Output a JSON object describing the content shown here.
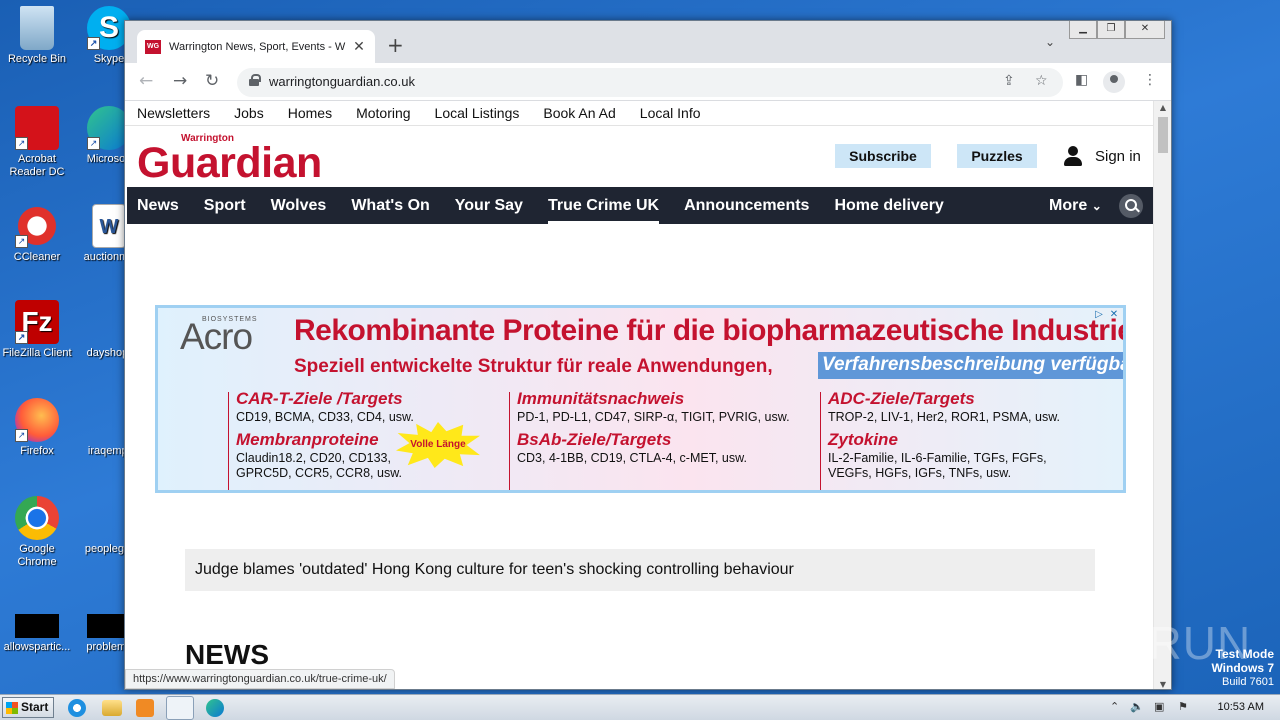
{
  "desktop": {
    "icons": [
      {
        "label": "Recycle Bin"
      },
      {
        "label": "Skype"
      },
      {
        "label": "Acrobat Reader DC"
      },
      {
        "label": "Microsoft"
      },
      {
        "label": "CCleaner"
      },
      {
        "label": "auctionme"
      },
      {
        "label": "FileZilla Client"
      },
      {
        "label": "dayshop."
      },
      {
        "label": "Firefox"
      },
      {
        "label": "iraqempl"
      },
      {
        "label": "Google Chrome"
      },
      {
        "label": "peopleget"
      },
      {
        "label": "allowspartic..."
      },
      {
        "label": "problems"
      }
    ]
  },
  "browser": {
    "tab": {
      "title": "Warrington News, Sport, Events - W",
      "favicon_text": "WG"
    },
    "address": {
      "url": "warringtonguardian.co.uk"
    },
    "status_url": "https://www.warringtonguardian.co.uk/true-crime-uk/"
  },
  "site": {
    "topnav": [
      "Newsletters",
      "Jobs",
      "Homes",
      "Motoring",
      "Local Listings",
      "Book An Ad",
      "Local Info"
    ],
    "logo_small": "Warrington",
    "logo_big": "Guardian",
    "subscribe_label": "Subscribe",
    "puzzles_label": "Puzzles",
    "signin_label": "Sign in",
    "mainnav": [
      "News",
      "Sport",
      "Wolves",
      "What's On",
      "Your Say",
      "True Crime UK",
      "Announcements",
      "Home delivery"
    ],
    "more_label": "More",
    "headline": "Judge blames 'outdated' Hong Kong culture for teen's shocking controlling behaviour",
    "section_title": "NEWS"
  },
  "ad": {
    "brand_small": "BIOSYSTEMS",
    "brand": "Acro",
    "headline": "Rekombinante Proteine für die biopharmazeutische Industrie",
    "subline": "Speziell entwickelte Struktur für reale Anwendungen,",
    "subline_badge": "Verfahrensbeschreibung verfügbar",
    "burst": "Volle Länge",
    "columns": [
      {
        "t1": "CAR-T-Ziele /Targets",
        "b1": "CD19, BCMA, CD33, CD4, usw.",
        "t2": "Membranproteine",
        "b2": "Claudin18.2, CD20, CD133, GPRC5D, CCR5, CCR8, usw."
      },
      {
        "t1": "Immunitätsnachweis",
        "b1": "PD-1, PD-L1, CD47, SIRP-α, TIGIT, PVRIG, usw.",
        "t2": "BsAb-Ziele/Targets",
        "b2": "CD3, 4-1BB, CD19, CTLA-4, c-MET, usw."
      },
      {
        "t1": "ADC-Ziele/Targets",
        "b1": "TROP-2, LIV-1, Her2, ROR1, PSMA, usw.",
        "t2": "Zytokine",
        "b2": "IL-2-Familie, IL-6-Familie, TGFs, FGFs, VEGFs, HGFs, IGFs, TNFs, usw."
      }
    ]
  },
  "watermark": "ANY RUN",
  "system": {
    "test_mode": "Test Mode",
    "os": "Windows 7",
    "build": "Build 7601",
    "start_label": "Start",
    "clock": "10:53 AM"
  },
  "colors": {
    "brand_red": "#c4122f",
    "nav_dark": "#1f2532",
    "button_blue": "#cde6f7"
  }
}
